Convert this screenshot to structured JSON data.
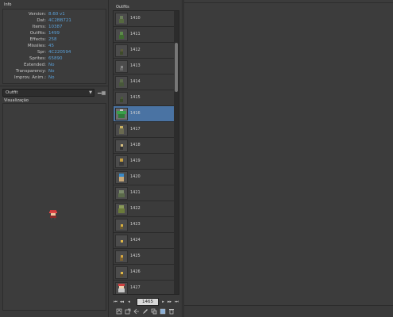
{
  "info": {
    "title": "Info",
    "rows": [
      {
        "label": "Version:",
        "value": "8.60 v1"
      },
      {
        "label": "Dat:",
        "value": "4C2BB721"
      },
      {
        "label": "Items:",
        "value": "10387"
      },
      {
        "label": "Outfits:",
        "value": "1499"
      },
      {
        "label": "Effects:",
        "value": "258"
      },
      {
        "label": "Missiles:",
        "value": "45"
      },
      {
        "label": "Spr:",
        "value": "4C220594"
      },
      {
        "label": "Sprites:",
        "value": "65890"
      },
      {
        "label": "Extended:",
        "value": "No"
      },
      {
        "label": "Transparency:",
        "value": "No"
      },
      {
        "label": "Improv. Anim.:",
        "value": "No"
      }
    ]
  },
  "category": {
    "selected": "Outfit",
    "action_icon": "export-icon"
  },
  "preview": {
    "title": "Visualização",
    "sprite_icon": "outfit-sprite-icon"
  },
  "outfits": {
    "title": "Outfits",
    "items": [
      "1410",
      "1411",
      "1412",
      "1413",
      "1414",
      "1415",
      "1416",
      "1417",
      "1418",
      "1419",
      "1420",
      "1421",
      "1422",
      "1423",
      "1424",
      "1425",
      "1426",
      "1427"
    ],
    "selected": "1416",
    "page_value": "1465"
  },
  "pager_icons": [
    "first-page-icon",
    "previous-page-icon",
    "previous-icon",
    "next-icon",
    "next-page-icon",
    "last-page-icon"
  ],
  "toolbar_icons": [
    "replace-icon",
    "export-icon",
    "import-icon",
    "edit-icon",
    "duplicate-icon",
    "new-icon",
    "delete-icon"
  ],
  "colors": {
    "accent_value": "#5aa0d8",
    "selection": "#4a73a3"
  }
}
